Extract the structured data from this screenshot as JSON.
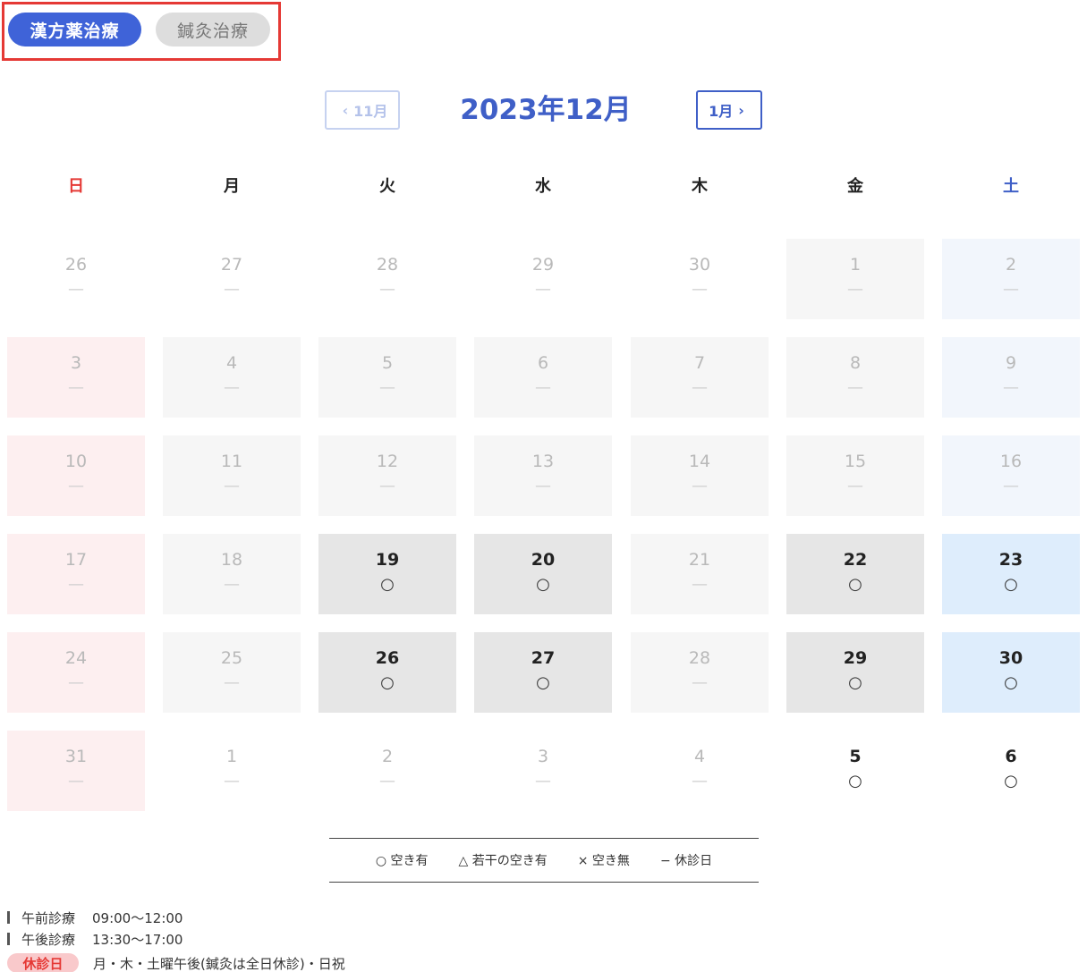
{
  "tabs": [
    {
      "label": "漢方薬治療",
      "active": true
    },
    {
      "label": "鍼灸治療",
      "active": false
    }
  ],
  "calendar": {
    "title": "2023年12月",
    "prev_label": "11月",
    "next_label": "1月",
    "weekdays": [
      "日",
      "月",
      "火",
      "水",
      "木",
      "金",
      "土"
    ],
    "weeks": [
      [
        {
          "day": "26",
          "mark": "—",
          "style": "none"
        },
        {
          "day": "27",
          "mark": "—",
          "style": "none"
        },
        {
          "day": "28",
          "mark": "—",
          "style": "none"
        },
        {
          "day": "29",
          "mark": "—",
          "style": "none"
        },
        {
          "day": "30",
          "mark": "—",
          "style": "none"
        },
        {
          "day": "1",
          "mark": "—",
          "style": "bg-plain"
        },
        {
          "day": "2",
          "mark": "—",
          "style": "bg-sat"
        }
      ],
      [
        {
          "day": "3",
          "mark": "—",
          "style": "bg-sun"
        },
        {
          "day": "4",
          "mark": "—",
          "style": "bg-plain"
        },
        {
          "day": "5",
          "mark": "—",
          "style": "bg-plain"
        },
        {
          "day": "6",
          "mark": "—",
          "style": "bg-plain"
        },
        {
          "day": "7",
          "mark": "—",
          "style": "bg-plain"
        },
        {
          "day": "8",
          "mark": "—",
          "style": "bg-plain"
        },
        {
          "day": "9",
          "mark": "—",
          "style": "bg-sat"
        }
      ],
      [
        {
          "day": "10",
          "mark": "—",
          "style": "bg-sun"
        },
        {
          "day": "11",
          "mark": "—",
          "style": "bg-plain"
        },
        {
          "day": "12",
          "mark": "—",
          "style": "bg-plain"
        },
        {
          "day": "13",
          "mark": "—",
          "style": "bg-plain"
        },
        {
          "day": "14",
          "mark": "—",
          "style": "bg-plain"
        },
        {
          "day": "15",
          "mark": "—",
          "style": "bg-plain"
        },
        {
          "day": "16",
          "mark": "—",
          "style": "bg-sat"
        }
      ],
      [
        {
          "day": "17",
          "mark": "—",
          "style": "bg-sun"
        },
        {
          "day": "18",
          "mark": "—",
          "style": "bg-plain"
        },
        {
          "day": "19",
          "mark": "○",
          "style": "avail"
        },
        {
          "day": "20",
          "mark": "○",
          "style": "avail"
        },
        {
          "day": "21",
          "mark": "—",
          "style": "bg-plain"
        },
        {
          "day": "22",
          "mark": "○",
          "style": "avail"
        },
        {
          "day": "23",
          "mark": "○",
          "style": "avail-sat"
        }
      ],
      [
        {
          "day": "24",
          "mark": "—",
          "style": "bg-sun"
        },
        {
          "day": "25",
          "mark": "—",
          "style": "bg-plain"
        },
        {
          "day": "26",
          "mark": "○",
          "style": "avail"
        },
        {
          "day": "27",
          "mark": "○",
          "style": "avail"
        },
        {
          "day": "28",
          "mark": "—",
          "style": "bg-plain"
        },
        {
          "day": "29",
          "mark": "○",
          "style": "avail"
        },
        {
          "day": "30",
          "mark": "○",
          "style": "avail-sat"
        }
      ],
      [
        {
          "day": "31",
          "mark": "—",
          "style": "bg-sun"
        },
        {
          "day": "1",
          "mark": "—",
          "style": "none"
        },
        {
          "day": "2",
          "mark": "—",
          "style": "none"
        },
        {
          "day": "3",
          "mark": "—",
          "style": "none"
        },
        {
          "day": "4",
          "mark": "—",
          "style": "none"
        },
        {
          "day": "5",
          "mark": "○",
          "style": "open"
        },
        {
          "day": "6",
          "mark": "○",
          "style": "open"
        }
      ]
    ]
  },
  "legend": [
    "○ 空き有",
    "△ 若干の空き有",
    "× 空き無",
    "− 休診日"
  ],
  "hours": {
    "morning_label": "午前診療",
    "morning_time": "09:00〜12:00",
    "afternoon_label": "午後診療",
    "afternoon_time": "13:30〜17:00",
    "holiday_label": "休診日",
    "holiday_text": "月・木・土曜午後(鍼灸は全日休診)・日祝"
  },
  "colors": {
    "accent": "#3f63d8",
    "sunday": "#e53935",
    "saturday": "#3f5fc7",
    "highlight_frame": "#e53935"
  }
}
